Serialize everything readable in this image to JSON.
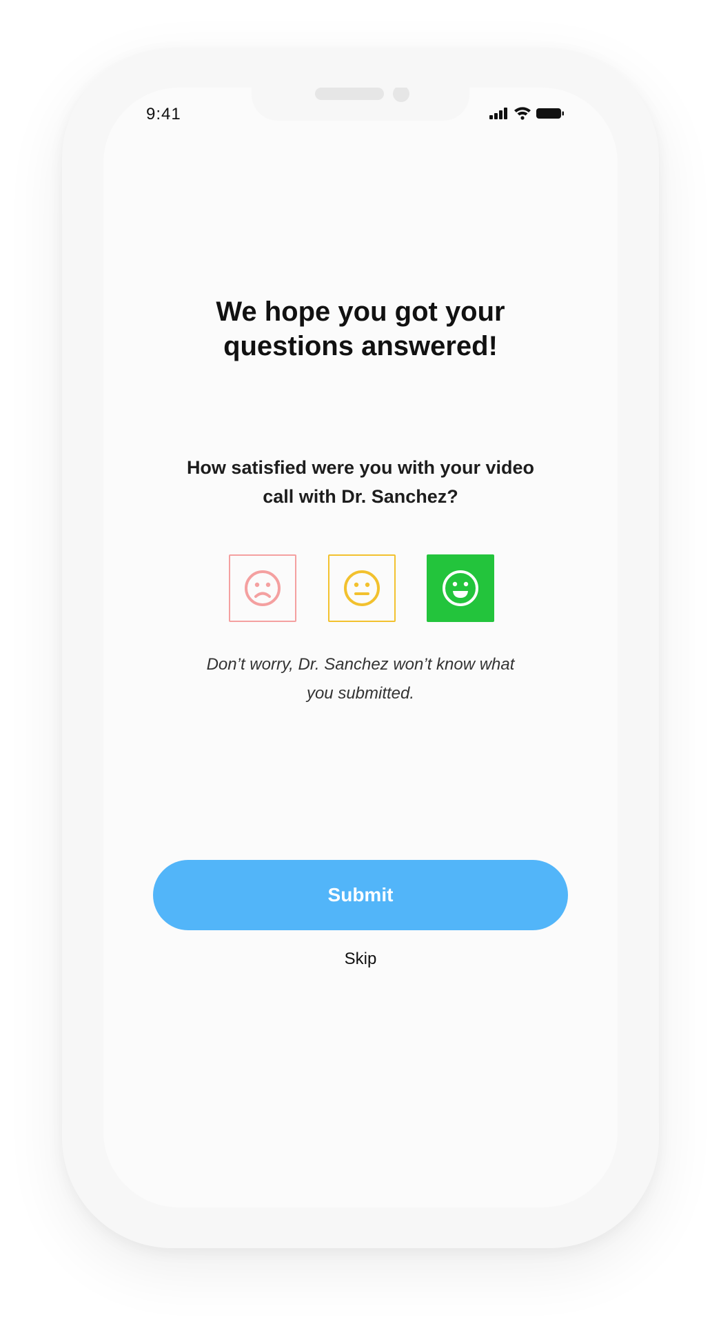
{
  "status_bar": {
    "time": "9:41",
    "signal_icon": "cellular-signal-icon",
    "wifi_icon": "wifi-icon",
    "battery_icon": "battery-icon"
  },
  "survey": {
    "title": "We hope you got your questions answered!",
    "question": "How satisfied were you with your video call with Dr. Sanchez?",
    "options": [
      {
        "icon": "sad-face-icon",
        "color": "#f4a0a0",
        "selected": false
      },
      {
        "icon": "neutral-face-icon",
        "color": "#f2c12e",
        "selected": false
      },
      {
        "icon": "happy-face-icon",
        "color": "#23c43c",
        "selected": true
      }
    ],
    "note": "Don’t worry, Dr. Sanchez won’t know what you submitted.",
    "submit_label": "Submit",
    "skip_label": "Skip"
  },
  "colors": {
    "accent": "#52b5f9",
    "background": "#fbfbfb"
  }
}
